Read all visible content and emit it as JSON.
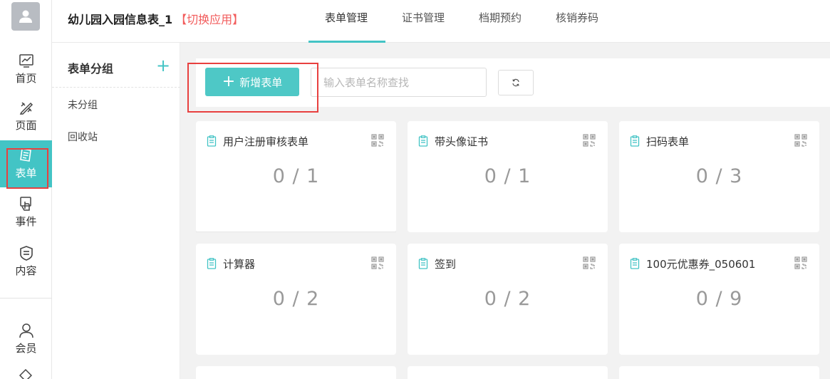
{
  "colors": {
    "accent": "#43c4c5",
    "switch": "#f25b5b",
    "annotation": "#e8403f"
  },
  "header": {
    "app_name": "幼儿园入园信息表_1",
    "switch_label": "【切换应用】",
    "tabs": [
      {
        "label": "表单管理",
        "active": true
      },
      {
        "label": "证书管理",
        "active": false
      },
      {
        "label": "档期预约",
        "active": false
      },
      {
        "label": "核销券码",
        "active": false
      }
    ]
  },
  "rail": {
    "items": [
      {
        "label": "首页",
        "icon": "chart-icon"
      },
      {
        "label": "页面",
        "icon": "design-icon"
      },
      {
        "label": "表单",
        "icon": "form-icon",
        "active": true
      },
      {
        "label": "事件",
        "icon": "touch-icon"
      },
      {
        "label": "内容",
        "icon": "content-icon"
      },
      {
        "label": "会员",
        "icon": "user-icon"
      }
    ]
  },
  "groups": {
    "title": "表单分组",
    "add_symbol": "+",
    "items": [
      {
        "label": "未分组"
      },
      {
        "label": "回收站"
      }
    ]
  },
  "toolbar": {
    "new_label": "新增表单",
    "search_placeholder": "输入表单名称查找"
  },
  "forms": [
    {
      "name": "用户注册审核表单",
      "count": "0 / 1"
    },
    {
      "name": "带头像证书",
      "count": "0 / 1"
    },
    {
      "name": "扫码表单",
      "count": "0 / 3"
    },
    {
      "name": "计算器",
      "count": "0 / 2"
    },
    {
      "name": "签到",
      "count": "0 / 2"
    },
    {
      "name": "100元优惠券_050601",
      "count": "0 / 9"
    }
  ]
}
